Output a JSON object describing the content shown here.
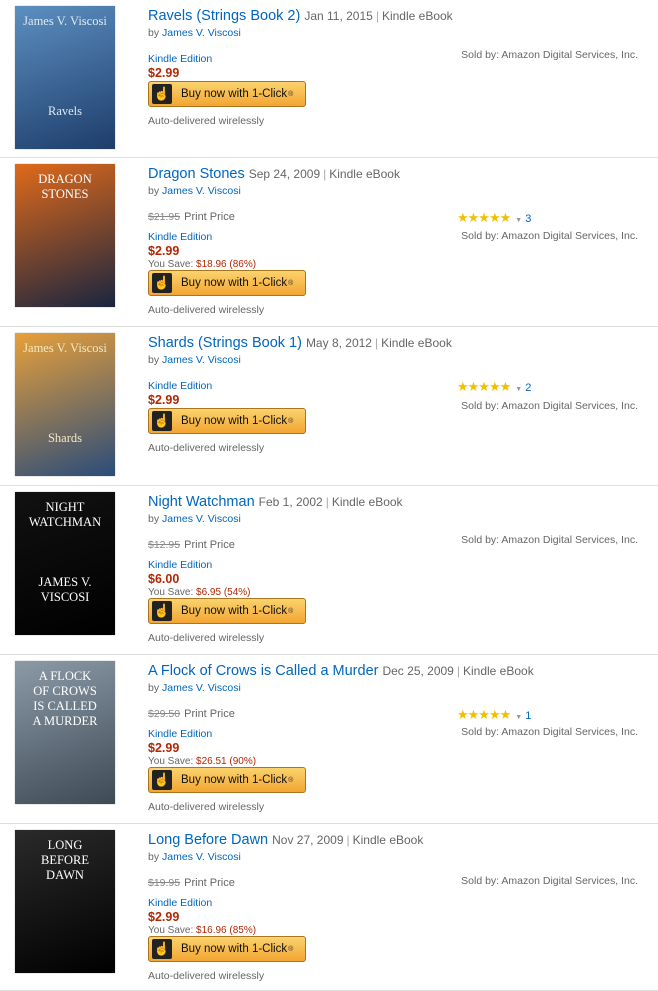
{
  "common": {
    "buy_label": "Buy now with 1-Click",
    "buy_reg": "®",
    "delivered": "Auto-delivered wirelessly",
    "sold_by": "Sold by: Amazon Digital Services, Inc.",
    "print_price_label": "Print Price",
    "you_save_label": "You Save:",
    "format": "Kindle eBook",
    "edition": "Kindle Edition",
    "by": "by",
    "stars": "★★★★★",
    "caret": "▼",
    "icon": "1-click-hand-icon"
  },
  "books": [
    {
      "title": "Ravels (Strings Book 2)",
      "date": "Jan 11, 2015",
      "author": "James V. Viscosi",
      "price": "$2.99",
      "cover": {
        "colors": [
          "#5c8fc0",
          "#1e3d6b"
        ],
        "lines": [
          "James V. Viscosi",
          "",
          "",
          "",
          "",
          "",
          "Ravels"
        ],
        "text_color": "#dde8f5"
      }
    },
    {
      "title": "Dragon Stones",
      "date": "Sep 24, 2009",
      "author": "James V. Viscosi",
      "print_price": "$21.95",
      "price": "$2.99",
      "you_save": "$18.96 (86%)",
      "rating_count": "3",
      "cover": {
        "colors": [
          "#e06a1a",
          "#1a2540"
        ],
        "lines": [
          "DRAGON",
          "STONES"
        ],
        "text_color": "#ffffff"
      }
    },
    {
      "title": "Shards (Strings Book 1)",
      "date": "May 8, 2012",
      "author": "James V. Viscosi",
      "price": "$2.99",
      "rating_count": "2",
      "cover": {
        "colors": [
          "#e8a03a",
          "#2a4c7a"
        ],
        "lines": [
          "James V. Viscosi",
          "",
          "",
          "",
          "",
          "",
          "Shards"
        ],
        "text_color": "#f4e8c0"
      }
    },
    {
      "title": "Night Watchman",
      "date": "Feb 1, 2002",
      "author": "James V. Viscosi",
      "print_price": "$12.95",
      "price": "$6.00",
      "you_save": "$6.95 (54%)",
      "cover": {
        "colors": [
          "#111111",
          "#000000"
        ],
        "lines": [
          "NIGHT",
          "WATCHMAN",
          "",
          "",
          "",
          "JAMES V.",
          "VISCOSI"
        ],
        "text_color": "#ffffff"
      }
    },
    {
      "title": "A Flock of Crows is Called a Murder",
      "date": "Dec 25, 2009",
      "author": "James V. Viscosi",
      "print_price": "$29.50",
      "price": "$2.99",
      "you_save": "$26.51 (90%)",
      "rating_count": "1",
      "cover": {
        "colors": [
          "#8c9aa8",
          "#3e4a55"
        ],
        "lines": [
          "A FLOCK",
          "OF CROWS",
          "IS CALLED",
          "A MURDER"
        ],
        "text_color": "#ffffff"
      }
    },
    {
      "title": "Long Before Dawn",
      "date": "Nov 27, 2009",
      "author": "James V. Viscosi",
      "print_price": "$19.95",
      "price": "$2.99",
      "you_save": "$16.96 (85%)",
      "cover": {
        "colors": [
          "#2a2a2a",
          "#000000"
        ],
        "lines": [
          "LONG",
          "BEFORE",
          "DAWN"
        ],
        "text_color": "#ffffff"
      }
    }
  ]
}
